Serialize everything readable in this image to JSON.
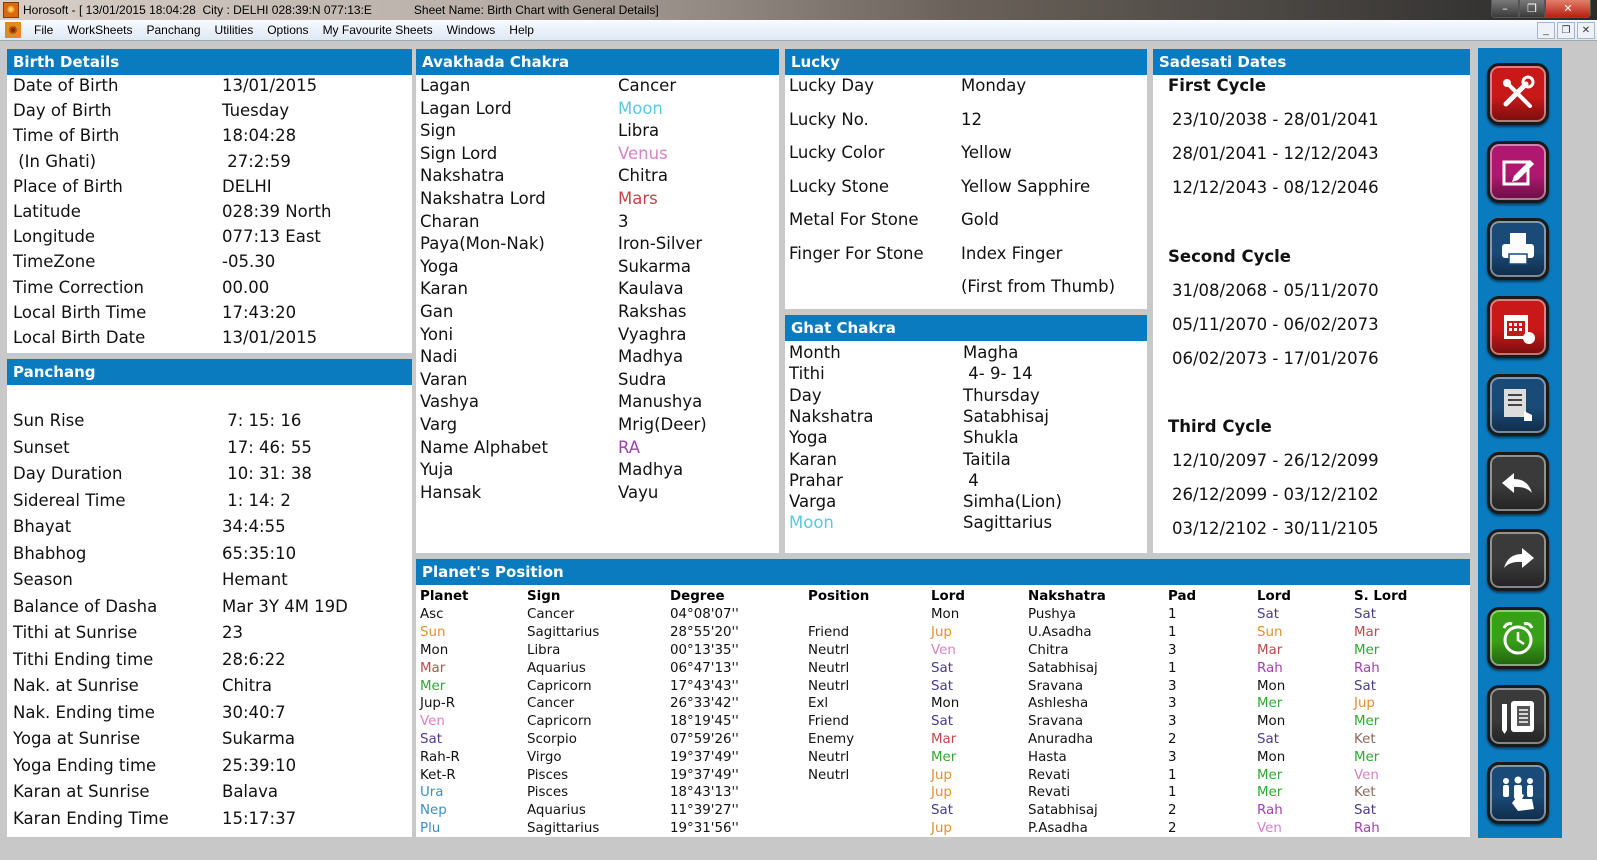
{
  "window": {
    "title_left": "Horosoft - [ 13/01/2015 18:04:28  City : DELHI 028:39:N 077:13:E",
    "title_right": "Sheet Name: Birth Chart with General Details]",
    "minimize": "–",
    "maximize": "❐",
    "close": "✕"
  },
  "menu": {
    "items": [
      "File",
      "WorkSheets",
      "Panchang",
      "Utilities",
      "Options",
      "My Favourite Sheets",
      "Windows",
      "Help"
    ],
    "mdi_minimize": "_",
    "mdi_restore": "❐",
    "mdi_close": "✕"
  },
  "colors": {
    "header_blue": "#0a7bbf",
    "sun": "#e09030",
    "moon": "#5ac8e0",
    "mars": "#c04848",
    "mercury": "#30a830",
    "venus": "#d880c8",
    "saturn": "#4a3a8a",
    "rahu": "#a040b0",
    "ketu": "#8a6a5a",
    "uranus": "#3a90c0",
    "jupiter": "#e09030"
  },
  "birth_details": {
    "title": "Birth Details",
    "rows": [
      {
        "k": "Date of Birth",
        "v": "13/01/2015"
      },
      {
        "k": "Day of Birth",
        "v": "Tuesday"
      },
      {
        "k": "Time of Birth",
        "v": "18:04:28"
      },
      {
        "k": " (In Ghati)",
        "v": " 27:2:59"
      },
      {
        "k": "Place of Birth",
        "v": "DELHI"
      },
      {
        "k": "Latitude",
        "v": "028:39 North"
      },
      {
        "k": "Longitude",
        "v": "077:13 East"
      },
      {
        "k": "TimeZone",
        "v": "-05.30"
      },
      {
        "k": "Time Correction",
        "v": "00.00"
      },
      {
        "k": "Local Birth Time",
        "v": "17:43:20"
      },
      {
        "k": "Local Birth Date",
        "v": "13/01/2015"
      }
    ]
  },
  "panchang": {
    "title": "Panchang",
    "rows": [
      {
        "k": "Sun Rise",
        "v": " 7: 15: 16"
      },
      {
        "k": "Sunset",
        "v": " 17: 46: 55"
      },
      {
        "k": "Day Duration",
        "v": " 10: 31: 38"
      },
      {
        "k": "Sidereal Time",
        "v": " 1: 14: 2"
      },
      {
        "k": "Bhayat",
        "v": "34:4:55"
      },
      {
        "k": "Bhabhog",
        "v": "65:35:10"
      },
      {
        "k": "Season",
        "v": "Hemant"
      },
      {
        "k": "Balance of Dasha",
        "v": "Mar 3Y 4M 19D"
      },
      {
        "k": "Tithi at Sunrise",
        "v": "23"
      },
      {
        "k": "Tithi Ending time",
        "v": "28:6:22"
      },
      {
        "k": "Nak. at Sunrise",
        "v": "Chitra"
      },
      {
        "k": "Nak. Ending time",
        "v": "30:40:7"
      },
      {
        "k": "Yoga at Sunrise",
        "v": "Sukarma"
      },
      {
        "k": "Yoga Ending time",
        "v": "25:39:10"
      },
      {
        "k": "Karan at Sunrise",
        "v": "Balava"
      },
      {
        "k": "Karan Ending Time",
        "v": "15:17:37"
      }
    ]
  },
  "avakhada": {
    "title": "Avakhada Chakra",
    "rows": [
      {
        "k": "Lagan",
        "v": "Cancer",
        "c": ""
      },
      {
        "k": "Lagan Lord",
        "v": "Moon",
        "c": "moon"
      },
      {
        "k": "Sign",
        "v": "Libra",
        "c": ""
      },
      {
        "k": "Sign Lord",
        "v": "Venus",
        "c": "venus"
      },
      {
        "k": "Nakshatra",
        "v": "Chitra",
        "c": ""
      },
      {
        "k": "Nakshatra Lord",
        "v": "Mars",
        "c": "mars"
      },
      {
        "k": "Charan",
        "v": "3",
        "c": ""
      },
      {
        "k": "Paya(Mon-Nak)",
        "v": "Iron-Silver",
        "c": ""
      },
      {
        "k": "Yoga",
        "v": "Sukarma",
        "c": ""
      },
      {
        "k": "Karan",
        "v": "Kaulava",
        "c": ""
      },
      {
        "k": "Gan",
        "v": "Rakshas",
        "c": ""
      },
      {
        "k": "Yoni",
        "v": "Vyaghra",
        "c": ""
      },
      {
        "k": "Nadi",
        "v": "Madhya",
        "c": ""
      },
      {
        "k": "Varan",
        "v": "Sudra",
        "c": ""
      },
      {
        "k": "Vashya",
        "v": "Manushya",
        "c": ""
      },
      {
        "k": "Varg",
        "v": "Mrig(Deer)",
        "c": ""
      },
      {
        "k": "Name Alphabet",
        "v": "RA",
        "c": "rahu"
      },
      {
        "k": "Yuja",
        "v": "Madhya",
        "c": ""
      },
      {
        "k": "Hansak",
        "v": "Vayu",
        "c": ""
      }
    ]
  },
  "lucky": {
    "title": "Lucky",
    "rows": [
      {
        "k": "Lucky Day",
        "v": "Monday"
      },
      {
        "k": "Lucky No.",
        "v": "12"
      },
      {
        "k": "Lucky Color",
        "v": "Yellow"
      },
      {
        "k": "Lucky Stone",
        "v": "Yellow Sapphire"
      },
      {
        "k": "Metal For Stone",
        "v": "Gold"
      },
      {
        "k": "Finger For Stone",
        "v": "Index Finger"
      },
      {
        "k": "",
        "v": "(First from Thumb)"
      }
    ]
  },
  "ghat_chakra": {
    "title": "Ghat Chakra",
    "rows": [
      {
        "k": "Month",
        "v": "Magha",
        "c": ""
      },
      {
        "k": "Tithi",
        "v": " 4- 9- 14",
        "c": ""
      },
      {
        "k": "Day",
        "v": "Thursday",
        "c": ""
      },
      {
        "k": "Nakshatra",
        "v": "Satabhisaj",
        "c": ""
      },
      {
        "k": "Yoga",
        "v": "Shukla",
        "c": ""
      },
      {
        "k": "Karan",
        "v": "Taitila",
        "c": ""
      },
      {
        "k": "Prahar",
        "v": " 4",
        "c": ""
      },
      {
        "k": "Varga",
        "v": "Simha(Lion)",
        "c": ""
      },
      {
        "k": "Moon",
        "v": "Sagittarius",
        "c": "moon"
      }
    ]
  },
  "sadesati": {
    "title": "Sadesati Dates",
    "cycles": [
      {
        "name": "First Cycle",
        "dates": [
          "23/10/2038 - 28/01/2041",
          "28/01/2041 - 12/12/2043",
          "12/12/2043 - 08/12/2046"
        ]
      },
      {
        "name": "Second Cycle",
        "dates": [
          "31/08/2068 - 05/11/2070",
          "05/11/2070 - 06/02/2073",
          "06/02/2073 - 17/01/2076"
        ]
      },
      {
        "name": "Third Cycle",
        "dates": [
          "12/10/2097 - 26/12/2099",
          "26/12/2099 - 03/12/2102",
          "03/12/2102 - 30/11/2105"
        ]
      }
    ]
  },
  "planets": {
    "title": "Planet's Position",
    "headers": [
      "Planet",
      "Sign",
      "Degree",
      "Position",
      "Lord",
      "Nakshatra",
      "Pad",
      "Lord",
      "S. Lord"
    ],
    "rows": [
      {
        "planet": "Asc",
        "pc": "",
        "sign": "Cancer",
        "degree": "04°08'07''",
        "position": "",
        "lord": "Mon",
        "lc": "",
        "nak": "Pushya",
        "pad": "1",
        "nlord": "Sat",
        "nlc": "saturn",
        "slord": "Sat",
        "slc": "saturn"
      },
      {
        "planet": "Sun",
        "pc": "sun",
        "sign": "Sagittarius",
        "degree": "28°55'20''",
        "position": "Friend",
        "lord": "Jup",
        "lc": "jupiter",
        "nak": "U.Asadha",
        "pad": "1",
        "nlord": "Sun",
        "nlc": "sun",
        "slord": "Mar",
        "slc": "mars"
      },
      {
        "planet": "Mon",
        "pc": "",
        "sign": "Libra",
        "degree": "00°13'35''",
        "position": "Neutrl",
        "lord": "Ven",
        "lc": "venus",
        "nak": "Chitra",
        "pad": "3",
        "nlord": "Mar",
        "nlc": "mars",
        "slord": "Mer",
        "slc": "mercury"
      },
      {
        "planet": "Mar",
        "pc": "mars",
        "sign": "Aquarius",
        "degree": "06°47'13''",
        "position": "Neutrl",
        "lord": "Sat",
        "lc": "saturn",
        "nak": "Satabhisaj",
        "pad": "1",
        "nlord": "Rah",
        "nlc": "rahu",
        "slord": "Rah",
        "slc": "rahu"
      },
      {
        "planet": "Mer",
        "pc": "mercury",
        "sign": "Capricorn",
        "degree": "17°43'43''",
        "position": "Neutrl",
        "lord": "Sat",
        "lc": "saturn",
        "nak": "Sravana",
        "pad": "3",
        "nlord": "Mon",
        "nlc": "",
        "slord": "Sat",
        "slc": "saturn"
      },
      {
        "planet": "Jup-R",
        "pc": "",
        "sign": "Cancer",
        "degree": "26°33'42''",
        "position": "Exl",
        "lord": "Mon",
        "lc": "",
        "nak": "Ashlesha",
        "pad": "3",
        "nlord": "Mer",
        "nlc": "mercury",
        "slord": "Jup",
        "slc": "jupiter"
      },
      {
        "planet": "Ven",
        "pc": "venus",
        "sign": "Capricorn",
        "degree": "18°19'45''",
        "position": "Friend",
        "lord": "Sat",
        "lc": "saturn",
        "nak": "Sravana",
        "pad": "3",
        "nlord": "Mon",
        "nlc": "",
        "slord": "Mer",
        "slc": "mercury"
      },
      {
        "planet": "Sat",
        "pc": "saturn",
        "sign": "Scorpio",
        "degree": "07°59'26''",
        "position": "Enemy",
        "lord": "Mar",
        "lc": "mars",
        "nak": "Anuradha",
        "pad": "2",
        "nlord": "Sat",
        "nlc": "saturn",
        "slord": "Ket",
        "slc": "ketu"
      },
      {
        "planet": "Rah-R",
        "pc": "",
        "sign": "Virgo",
        "degree": "19°37'49''",
        "position": "Neutrl",
        "lord": "Mer",
        "lc": "mercury",
        "nak": "Hasta",
        "pad": "3",
        "nlord": "Mon",
        "nlc": "",
        "slord": "Mer",
        "slc": "mercury"
      },
      {
        "planet": "Ket-R",
        "pc": "",
        "sign": "Pisces",
        "degree": "19°37'49''",
        "position": "Neutrl",
        "lord": "Jup",
        "lc": "jupiter",
        "nak": "Revati",
        "pad": "1",
        "nlord": "Mer",
        "nlc": "mercury",
        "slord": "Ven",
        "slc": "venus"
      },
      {
        "planet": "Ura",
        "pc": "uranus",
        "sign": "Pisces",
        "degree": "18°43'13''",
        "position": "",
        "lord": "Jup",
        "lc": "jupiter",
        "nak": "Revati",
        "pad": "1",
        "nlord": "Mer",
        "nlc": "mercury",
        "slord": "Ket",
        "slc": "ketu"
      },
      {
        "planet": "Nep",
        "pc": "uranus",
        "sign": "Aquarius",
        "degree": "11°39'27''",
        "position": "",
        "lord": "Sat",
        "lc": "saturn",
        "nak": "Satabhisaj",
        "pad": "2",
        "nlord": "Rah",
        "nlc": "rahu",
        "slord": "Sat",
        "slc": "saturn"
      },
      {
        "planet": "Plu",
        "pc": "uranus",
        "sign": "Sagittarius",
        "degree": "19°31'56''",
        "position": "",
        "lord": "Jup",
        "lc": "jupiter",
        "nak": "P.Asadha",
        "pad": "2",
        "nlord": "Ven",
        "nlc": "venus",
        "slord": "Rah",
        "slc": "rahu"
      }
    ]
  },
  "toolbar": {
    "buttons": [
      {
        "name": "tools-button",
        "icon": "wrench-screwdriver-icon",
        "color": "#c81818"
      },
      {
        "name": "edit-button",
        "icon": "edit-pencil-icon",
        "color": "#b01870"
      },
      {
        "name": "print-button",
        "icon": "printer-icon",
        "color": "#1a4a78"
      },
      {
        "name": "calendar-button",
        "icon": "calendar-icon",
        "color": "#c81818"
      },
      {
        "name": "sheet-select-button",
        "icon": "document-pointer-icon",
        "color": "#1a4a78"
      },
      {
        "name": "back-button",
        "icon": "arrow-left-icon",
        "color": "#3a3a3a"
      },
      {
        "name": "forward-button",
        "icon": "arrow-right-icon",
        "color": "#3a3a3a"
      },
      {
        "name": "alarm-button",
        "icon": "alarm-clock-icon",
        "color": "#38a018"
      },
      {
        "name": "notebook-button",
        "icon": "notebook-icon",
        "color": "#3a3a3a"
      },
      {
        "name": "group-select-button",
        "icon": "people-hand-icon",
        "color": "#1a4a78"
      }
    ]
  }
}
